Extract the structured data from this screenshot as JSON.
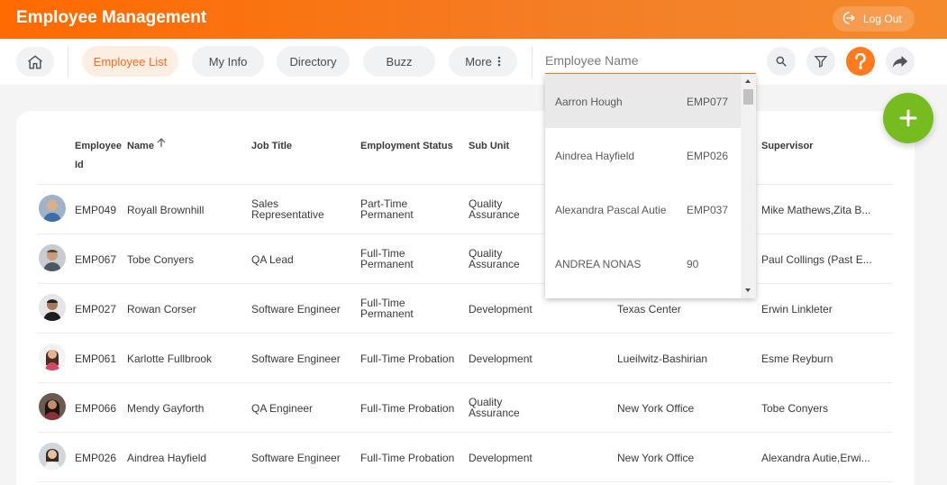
{
  "header": {
    "title": "Employee Management",
    "logout_label": "Log Out"
  },
  "nav": {
    "tabs": [
      {
        "label": "Employee List",
        "active": true
      },
      {
        "label": "My Info"
      },
      {
        "label": "Directory"
      },
      {
        "label": "Buzz"
      },
      {
        "label": "More"
      }
    ],
    "search_placeholder": "Employee Name"
  },
  "table": {
    "headers": {
      "employee_id_line1": "Employee",
      "employee_id_line2": "Id",
      "name": "Name",
      "job_title": "Job Title",
      "employment_status": "Employment Status",
      "sub_unit": "Sub Unit",
      "supervisor": "Supervisor"
    },
    "rows": [
      {
        "id": "EMP049",
        "name": "Royall Brownhill",
        "job_title": [
          "Sales",
          "Representative"
        ],
        "status": [
          "Part-Time",
          "Permanent"
        ],
        "sub_unit": [
          "Quality",
          "Assurance"
        ],
        "location": "",
        "supervisor": "Mike Mathews,Zita B..."
      },
      {
        "id": "EMP067",
        "name": "Tobe Conyers",
        "job_title": [
          "QA Lead"
        ],
        "status": [
          "Full-Time",
          "Permanent"
        ],
        "sub_unit": [
          "Quality",
          "Assurance"
        ],
        "location": "",
        "supervisor": "Paul Collings (Past E..."
      },
      {
        "id": "EMP027",
        "name": "Rowan Corser",
        "job_title": [
          "Software Engineer"
        ],
        "status": [
          "Full-Time",
          "Permanent"
        ],
        "sub_unit": [
          "Development"
        ],
        "location": "Texas Center",
        "supervisor": "Erwin Linkleter"
      },
      {
        "id": "EMP061",
        "name": "Karlotte Fullbrook",
        "job_title": [
          "Software Engineer"
        ],
        "status": [
          "Full-Time Probation"
        ],
        "sub_unit": [
          "Development"
        ],
        "location": "Lueilwitz-Bashirian",
        "supervisor": "Esme Reyburn"
      },
      {
        "id": "EMP066",
        "name": "Mendy Gayforth",
        "job_title": [
          "QA Engineer"
        ],
        "status": [
          "Full-Time Probation"
        ],
        "sub_unit": [
          "Quality",
          "Assurance"
        ],
        "location": "New York Office",
        "supervisor": "Tobe Conyers"
      },
      {
        "id": "EMP026",
        "name": "Aindrea Hayfield",
        "job_title": [
          "Software Engineer"
        ],
        "status": [
          "Full-Time Probation"
        ],
        "sub_unit": [
          "Development"
        ],
        "location": "New York Office",
        "supervisor": "Alexandra Autie,Erwi..."
      }
    ]
  },
  "autocomplete": [
    {
      "name": "Aarron Hough",
      "id": "EMP077"
    },
    {
      "name": "Aindrea Hayfield",
      "id": "EMP026"
    },
    {
      "name": "Alexandra Pascal Autie",
      "id": "EMP037"
    },
    {
      "name": "ANDREA NONAS",
      "id": "90"
    }
  ],
  "colors": {
    "brand": "#ff6a00",
    "accent": "#ff7b1d",
    "add": "#76bc21"
  },
  "icons": [
    "logout-icon",
    "home-icon",
    "more-dots-icon",
    "search-icon",
    "filter-icon",
    "help-icon",
    "share-icon",
    "sort-up-icon",
    "add-icon"
  ]
}
